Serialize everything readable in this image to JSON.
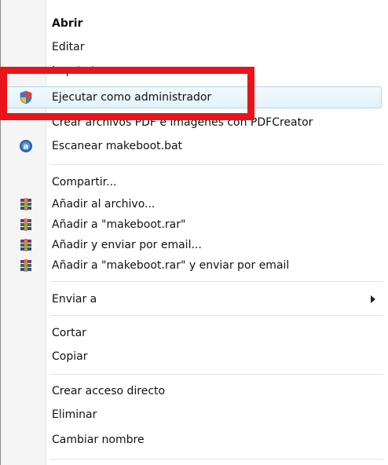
{
  "menu": {
    "open": "Abrir",
    "edit": "Editar",
    "print": "Imprimir",
    "run_as_admin": "Ejecutar como administrador",
    "pdfcreator": "Crear archivos PDF e imágenes con PDFCreator",
    "scan": "Escanear makeboot.bat",
    "share": "Compartir...",
    "add_to_archive": "Añadir al archivo...",
    "add_to_rar": "Añadir a \"makeboot.rar\"",
    "add_and_email": "Añadir y enviar por email...",
    "add_rar_and_email": "Añadir a \"makeboot.rar\" y enviar por email",
    "send_to": "Enviar a",
    "cut": "Cortar",
    "copy": "Copiar",
    "create_shortcut": "Crear acceso directo",
    "delete": "Eliminar",
    "rename": "Cambiar nombre"
  },
  "icons": {
    "shield": "uac-shield-icon",
    "antivirus": "antivirus-icon",
    "winrar": "winrar-icon",
    "submenu": "submenu-arrow-icon"
  },
  "colors": {
    "highlight_border": "#a8d8eb",
    "annotation_red": "#e8141a"
  }
}
